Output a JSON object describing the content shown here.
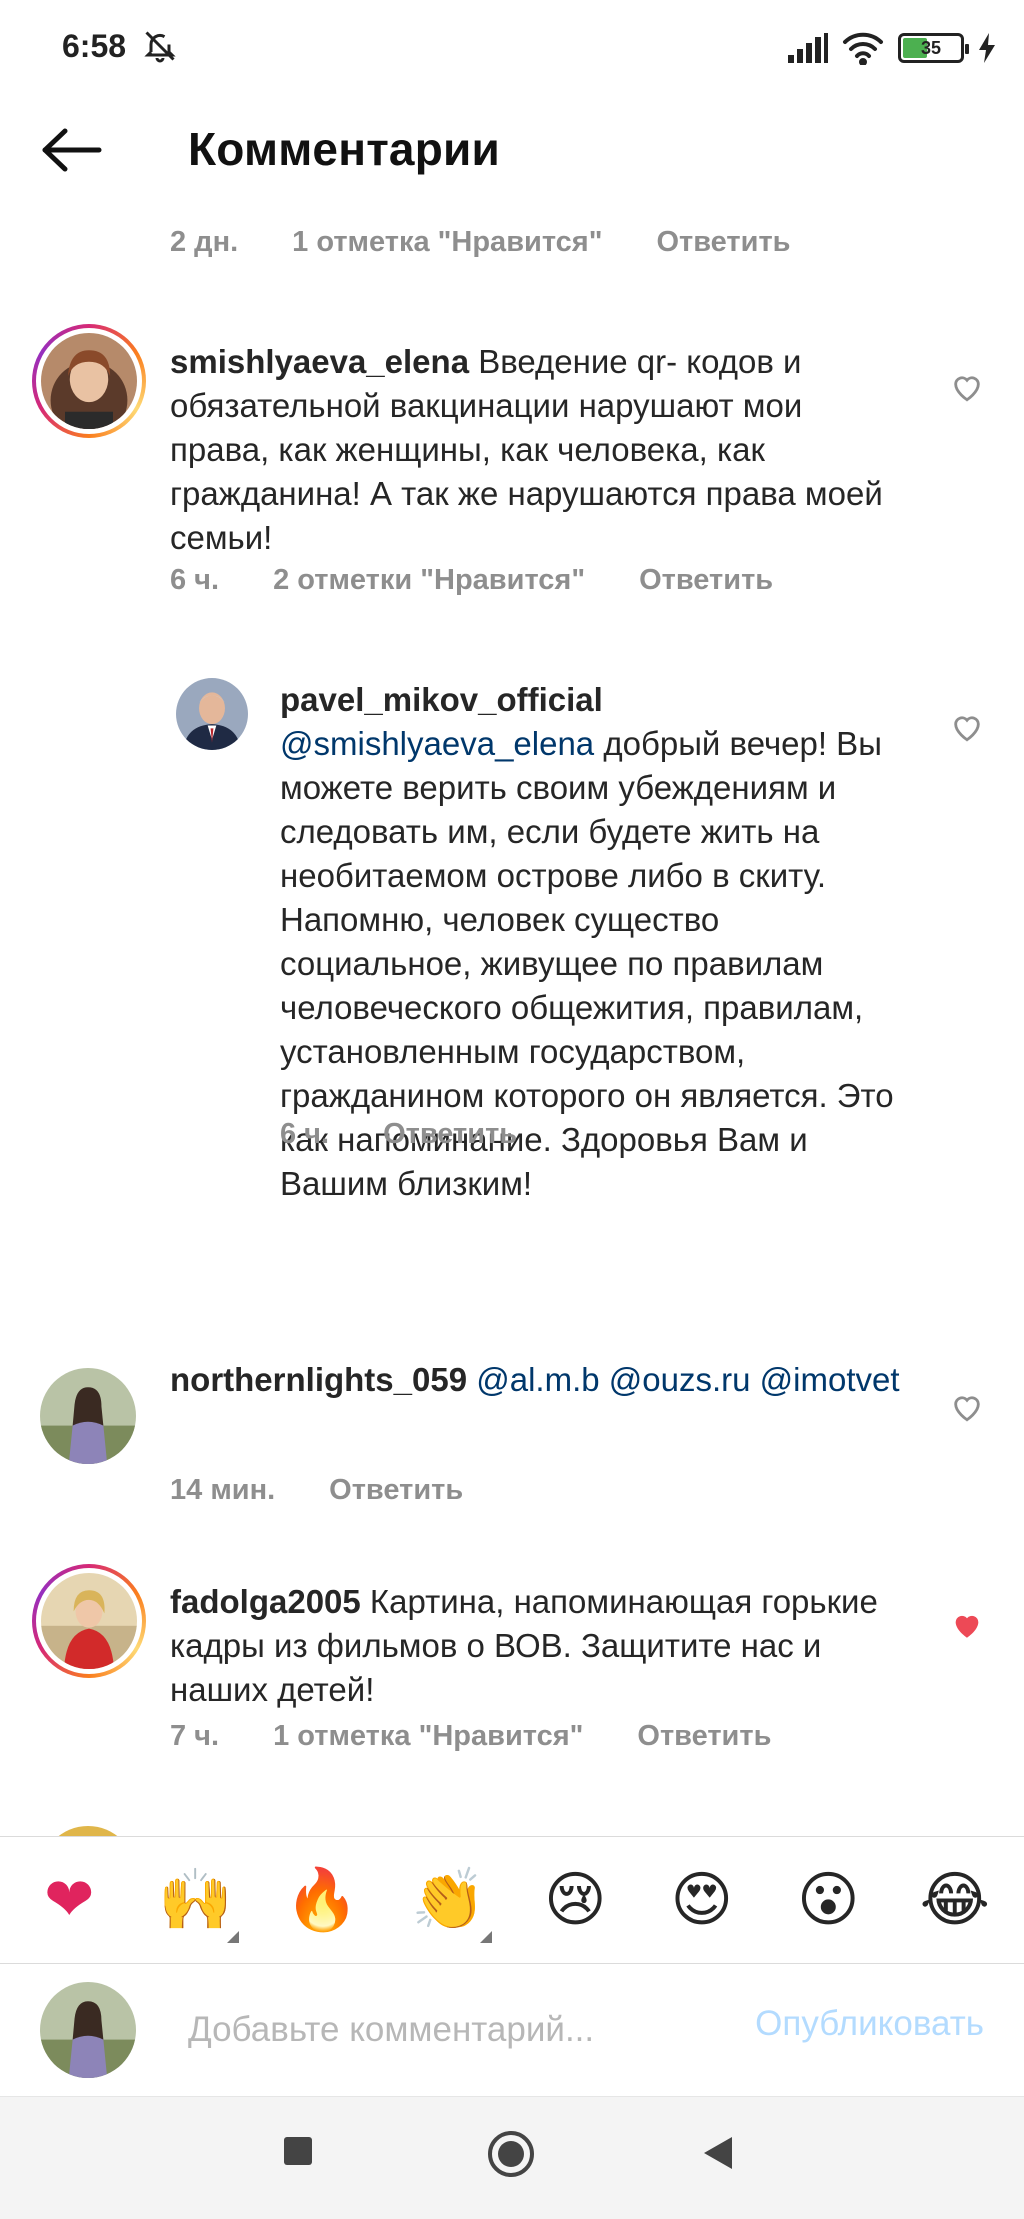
{
  "status_bar": {
    "time": "6:58",
    "battery": "35"
  },
  "header": {
    "title": "Комментарии"
  },
  "top_meta": {
    "time": "2 дн.",
    "likes": "1 отметка \"Нравится\"",
    "reply": "Ответить"
  },
  "comments": [
    {
      "username": "smishlyaeva_elena",
      "text": "Введение qr- кодов и обязательной вакцинации нарушают мои права, как женщины, как человека, как гражданина! А так же нарушаются права моей семьи!",
      "time": "6 ч.",
      "likes": "2 отметки \"Нравится\"",
      "reply": "Ответить"
    },
    {
      "username": "pavel_mikov_official",
      "mention": "@smishlyaeva_elena",
      "text": "добрый вечер! Вы можете верить своим убеждениям и следовать им, если будете жить на необитаемом острове либо в скиту. Напомню, человек существо социальное, живущее по правилам человеческого общежития, правилам, установленным государством, гражданином которого он является. Это как напоминание. Здоровья Вам и Вашим близким!",
      "time": "6 ч.",
      "reply": "Ответить"
    },
    {
      "username": "northernlights_059",
      "mentions": "@al.m.b @ouzs.ru @imotvet",
      "time": "14 мин.",
      "reply": "Ответить"
    },
    {
      "username": "fadolga2005",
      "text": "Картина, напоминающая горькие кадры из фильмов о ВОВ. Защитите нас и наших детей!",
      "time": "7 ч.",
      "likes": "1 отметка \"Нравится\"",
      "reply": "Ответить"
    }
  ],
  "emoji_bar": [
    "❤",
    "🙌",
    "🔥",
    "👏",
    "😢",
    "😍",
    "😮",
    "😂"
  ],
  "composer": {
    "placeholder": "Добавьте комментарий...",
    "publish": "Опубликовать"
  },
  "colors": {
    "like_red": "#ed4956",
    "mention_blue": "#00376b",
    "meta_gray": "#8e8e8e",
    "publish_disabled": "#b3dbff"
  }
}
